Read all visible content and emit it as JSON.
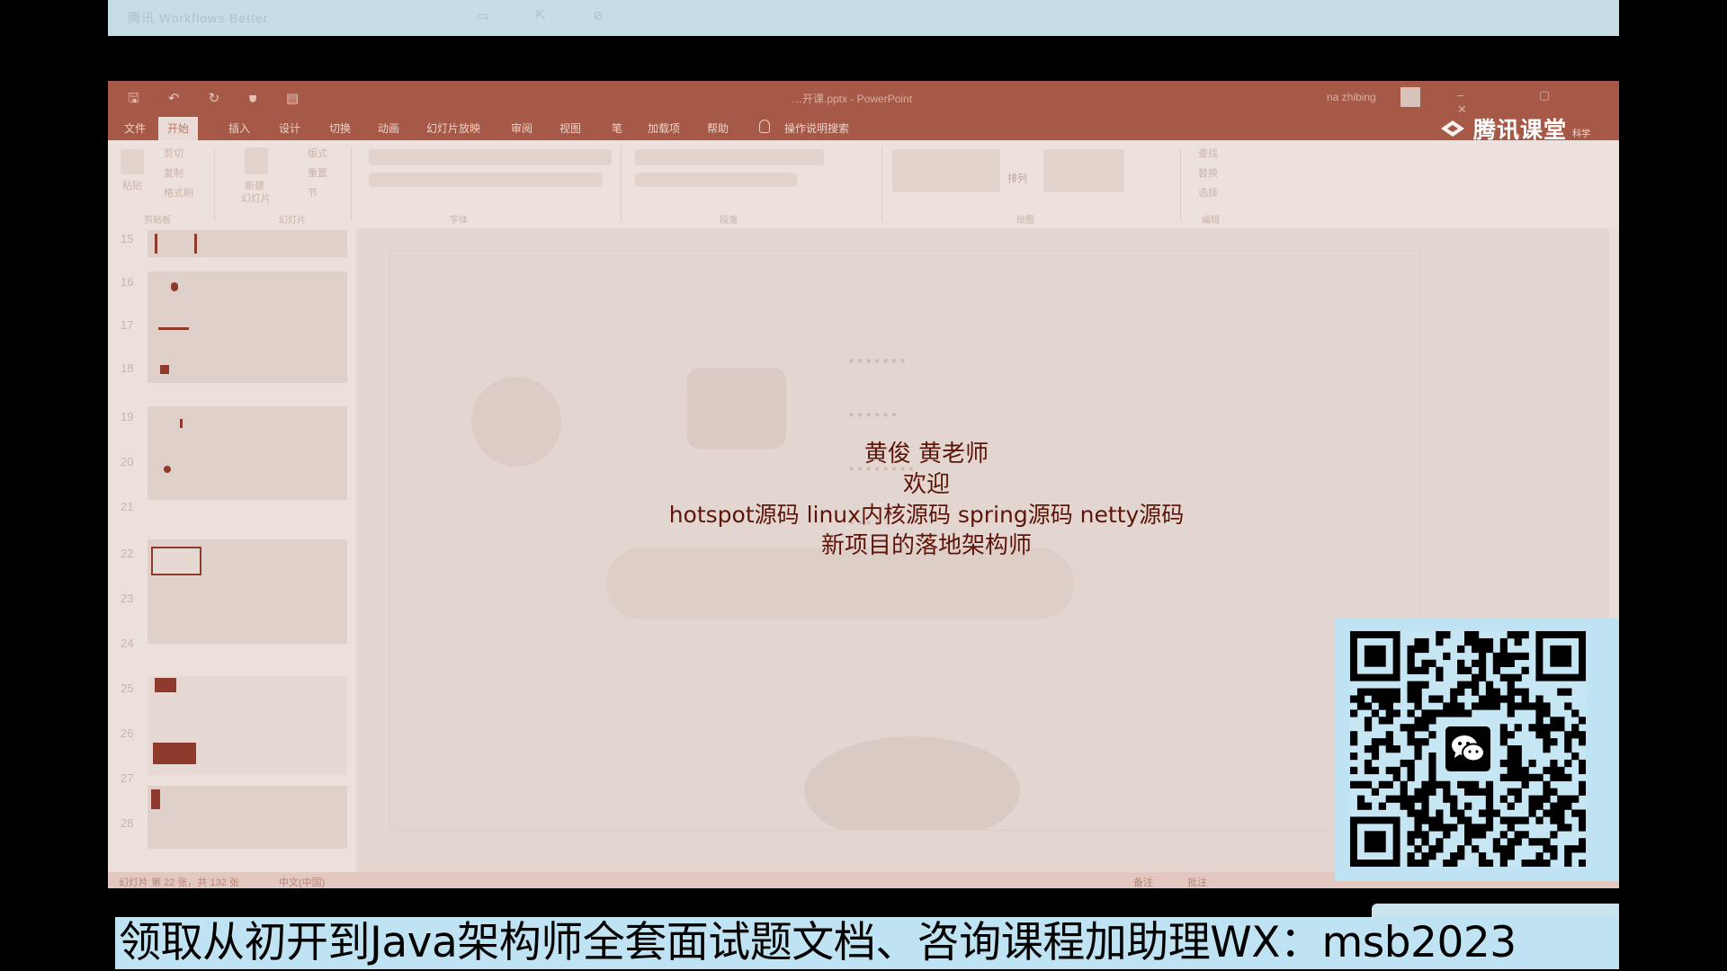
{
  "top_bar": {
    "text": "腾讯 Workflows Better",
    "icons": "▭ ⇱ ⊘"
  },
  "ppt": {
    "quick_access": "🖫 ↶ ↻ ⛊ ▤",
    "title": "…开课.pptx - PowerPoint",
    "user": "na zhibing",
    "window_controls": "– ▢ ✕",
    "tabs": [
      "文件",
      "开始",
      "插入",
      "设计",
      "切换",
      "动画",
      "幻灯片放映",
      "审阅",
      "视图",
      "笔",
      "加载项",
      "帮助",
      "操作说明搜索"
    ],
    "active_tab_index": 1,
    "brand": {
      "name": "腾讯课堂",
      "sub": "科学"
    },
    "ribbon": {
      "clipboard": {
        "paste": "粘贴",
        "cut": "剪切",
        "copy": "复制",
        "format_painter": "格式刷",
        "group": "剪贴板"
      },
      "slides": {
        "new_slide": "新建",
        "new_slide_sub": "幻灯片",
        "layout": "版式",
        "reset": "重置",
        "section": "节",
        "group": "幻灯片"
      },
      "font_group": "字体",
      "paragraph_group": "段落",
      "drawing": {
        "arrange": "排列",
        "group": "绘图"
      },
      "editing": {
        "find": "查找",
        "replace": "替换",
        "select": "选择",
        "group": "编辑"
      }
    },
    "slide_numbers": [
      "15",
      "16",
      "17",
      "18",
      "19",
      "20",
      "21",
      "22",
      "23",
      "24",
      "25",
      "26",
      "27",
      "28"
    ],
    "status": {
      "slide_info": "幻灯片 第 22 张，共 132 张",
      "language": "中文(中国)",
      "notes": "备注",
      "comments": "批注"
    }
  },
  "overlay": {
    "lines": [
      "黄俊 黄老师",
      "欢迎",
      "hotspot源码 linux内核源码 spring源码 netty源码",
      "新项目的落地架构师"
    ]
  },
  "qr": {
    "icon": "wechat-icon"
  },
  "banner": {
    "text": "领取从初开到Java架构师全套面试题文档、咨询课程加助理WX：msb2023"
  },
  "colors": {
    "ribbon_brand": "#a75947",
    "overlay_text": "#5d1509",
    "banner_bg": "#bfe3f2",
    "qr_bg": "#c7e6f3"
  }
}
